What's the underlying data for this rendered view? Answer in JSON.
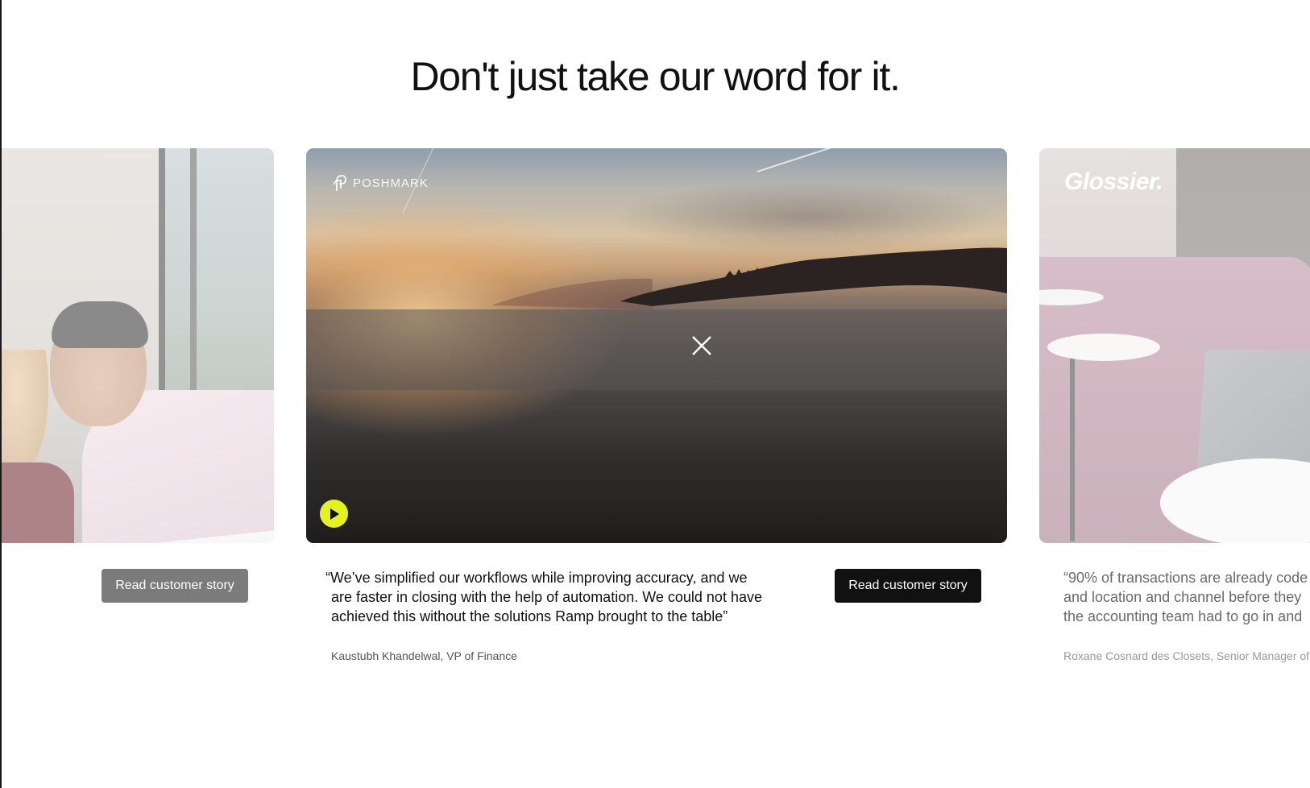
{
  "heading": "Don't just take our word for it.",
  "slides": {
    "left": {
      "cta_label": "Read customer story"
    },
    "center": {
      "logo_text": "POSHMARK",
      "quote_line1": "“We’ve simplified our workflows while improving accuracy, and we",
      "quote_line2": "are faster in closing with the help of automation. We could not have",
      "quote_line3": "achieved this without the solutions Ramp brought to the table”",
      "attribution": "Kaustubh Khandelwal, VP of Finance",
      "cta_label": "Read customer story"
    },
    "right": {
      "logo_text": "Glossier.",
      "quote_line1": "“90% of transactions are already code",
      "quote_line2": "and location and channel before they",
      "quote_line3": "the accounting team had to go in and",
      "attribution": "Roxane Cosnard des Closets, Senior Manager of"
    }
  },
  "colors": {
    "play_button": "#e4f222",
    "cta_active": "#111111",
    "cta_inactive": "#7b7b7b"
  },
  "icons": {
    "close": "close-icon",
    "play": "play-icon",
    "poshmark_logo": "poshmark-logo-icon"
  }
}
